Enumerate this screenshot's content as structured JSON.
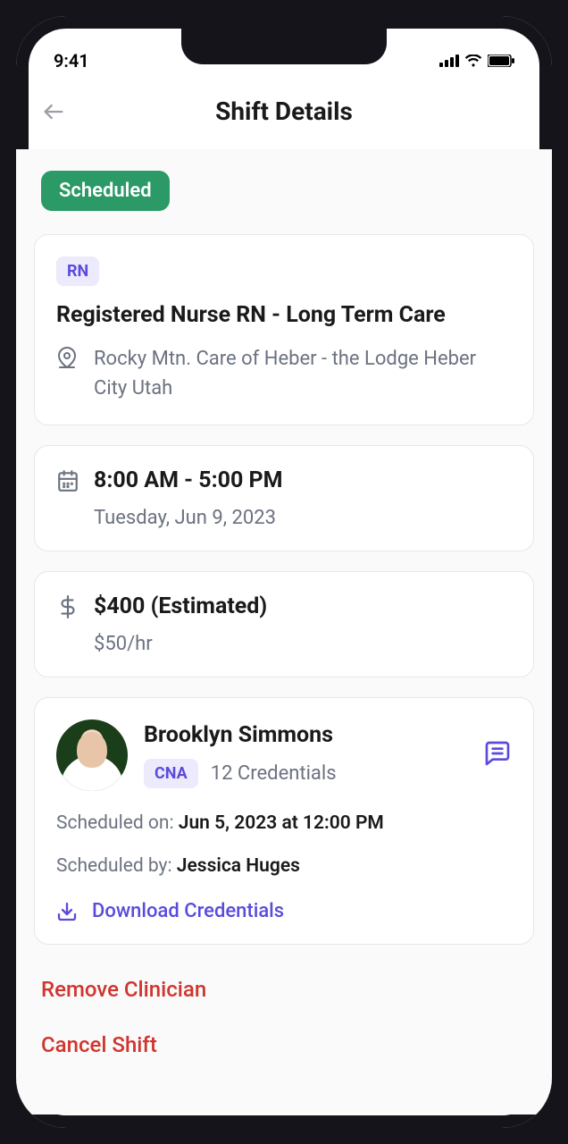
{
  "statusbar": {
    "time": "9:41"
  },
  "nav": {
    "title": "Shift Details"
  },
  "status_chip": "Scheduled",
  "job": {
    "role_pill": "RN",
    "title": "Registered Nurse RN - Long Term Care",
    "location": "Rocky Mtn. Care of Heber - the Lodge Heber City Utah"
  },
  "time": {
    "range": "8:00 AM -  5:00 PM",
    "date": "Tuesday, Jun 9, 2023"
  },
  "pay": {
    "total": "$400 (Estimated)",
    "rate": "$50/hr"
  },
  "clinician": {
    "name": "Brooklyn Simmons",
    "role_pill": "CNA",
    "credentials": "12 Credentials",
    "scheduled_on_label": "Scheduled on: ",
    "scheduled_on_value": "Jun 5, 2023 at 12:00 PM",
    "scheduled_by_label": "Scheduled by: ",
    "scheduled_by_value": "Jessica Huges",
    "download_label": "Download Credentials"
  },
  "actions": {
    "remove": "Remove Clinician",
    "cancel": "Cancel Shift"
  }
}
